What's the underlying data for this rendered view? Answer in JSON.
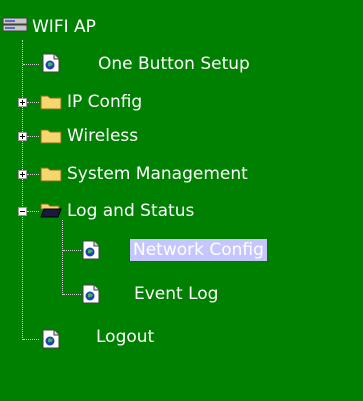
{
  "tree": {
    "root_label": "WIFI AP",
    "items": [
      {
        "label": "One Button Setup",
        "type": "page"
      },
      {
        "label": "IP Config",
        "type": "folder",
        "expanded": false
      },
      {
        "label": "Wireless",
        "type": "folder",
        "expanded": false
      },
      {
        "label": "System Management",
        "type": "folder",
        "expanded": false
      },
      {
        "label": "Log and Status",
        "type": "folder",
        "expanded": true,
        "children": [
          {
            "label": "Network Config",
            "type": "page",
            "selected": true
          },
          {
            "label": "Event Log",
            "type": "page"
          }
        ]
      },
      {
        "label": "Logout",
        "type": "page"
      }
    ]
  },
  "icons": {
    "root": "computer-icon",
    "page": "page-icon",
    "folder": "folder-icon",
    "open_folder": "open-folder-icon",
    "expand": "plus-icon",
    "collapse": "minus-icon"
  },
  "colors": {
    "background": "#008000",
    "text": "#ffffff",
    "selection": "#c6c6ff",
    "folder": "#f5d76e"
  }
}
